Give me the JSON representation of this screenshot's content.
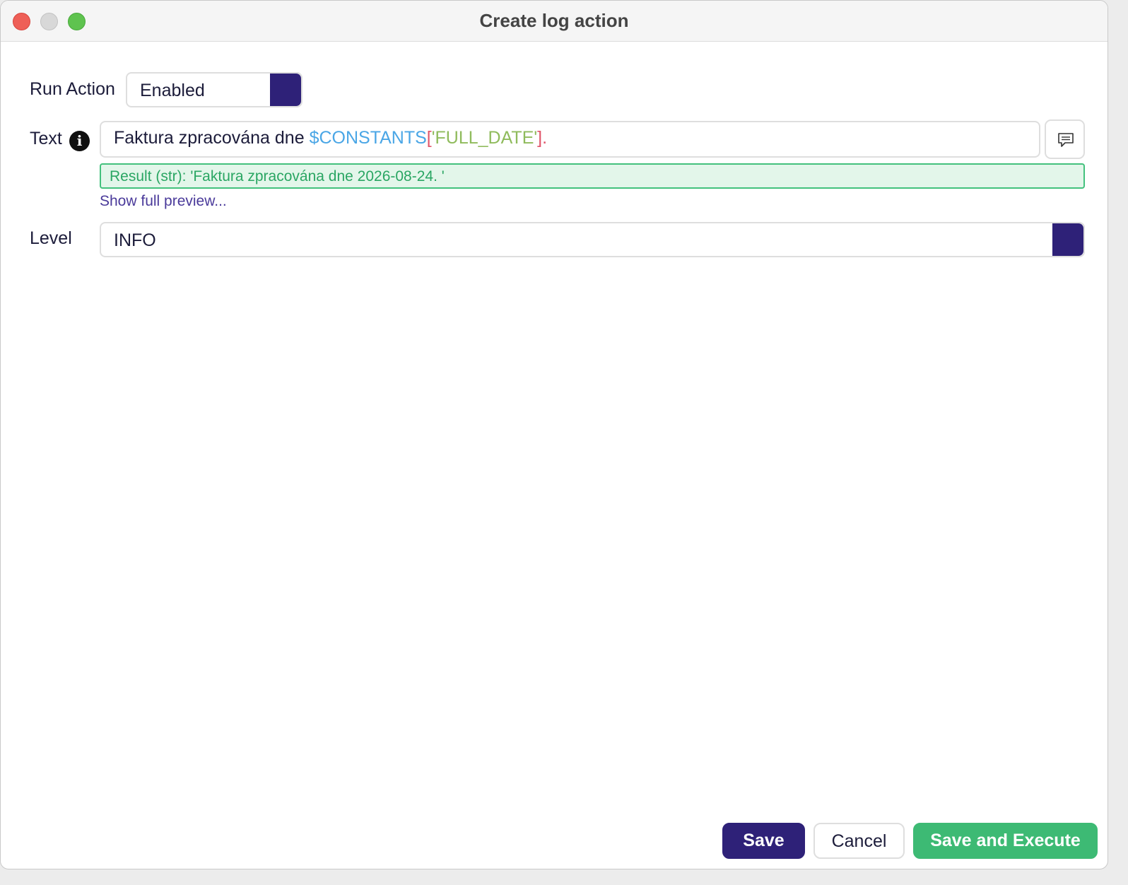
{
  "window": {
    "title": "Create log action"
  },
  "form": {
    "run_action": {
      "label": "Run Action",
      "value": "Enabled"
    },
    "text": {
      "label": "Text",
      "info_icon": "info-icon",
      "segments": {
        "plain": "Faktura zpracována dne ",
        "variable": "$CONSTANTS",
        "open_bracket": "[",
        "key": "'FULL_DATE'",
        "close_bracket": "]",
        "tail": "."
      },
      "comment_icon": "comment-icon",
      "result": "Result (str): 'Faktura zpracována dne 2026-08-24. '",
      "preview_link": "Show full preview..."
    },
    "level": {
      "label": "Level",
      "value": "INFO"
    }
  },
  "footer": {
    "save_label": "Save",
    "cancel_label": "Cancel",
    "save_execute_label": "Save and Execute"
  },
  "colors": {
    "primary": "#2e2178",
    "success": "#3dba74",
    "result_bg": "#e3f6ea",
    "variable": "#4aa6e6",
    "bracket": "#e0556a",
    "string": "#8fbb5c"
  }
}
